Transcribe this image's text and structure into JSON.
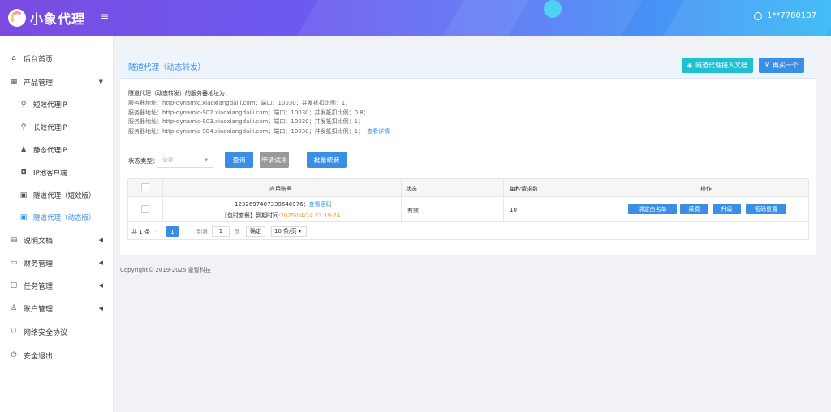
{
  "header": {
    "app_name": "小象代理",
    "menu_toggle": "≡",
    "username": "1**7780107"
  },
  "sidebar": {
    "items": [
      {
        "label": "后台首页",
        "icon": "home-icon"
      },
      {
        "label": "产品管理",
        "icon": "grid-icon"
      },
      {
        "label": "短效代理IP",
        "icon": "motorbike-icon"
      },
      {
        "label": "长效代理IP",
        "icon": "motorbike-icon"
      },
      {
        "label": "静态代理IP",
        "icon": "person-icon"
      },
      {
        "label": "IP池客户端",
        "icon": "car-icon"
      },
      {
        "label": "隧道代理（短效版）",
        "icon": "bus-icon"
      },
      {
        "label": "隧道代理（动态版）",
        "icon": "bus-icon"
      },
      {
        "label": "说明文档",
        "icon": "document-icon"
      },
      {
        "label": "财务管理",
        "icon": "folder-icon"
      },
      {
        "label": "任务管理",
        "icon": "calendar-icon"
      },
      {
        "label": "账户管理",
        "icon": "user-icon"
      },
      {
        "label": "网络安全协议",
        "icon": "shield-icon"
      },
      {
        "label": "安全退出",
        "icon": "power-icon"
      }
    ],
    "active_index": 7
  },
  "panel": {
    "title": "隧道代理（动态转发）",
    "doc_button": "隧道代理接入文档",
    "buy_button": "再买一个",
    "intro": "隧道代理（动态转发）的服务器地址为：",
    "servers": [
      "服务器地址：http-dynamic.xiaoxiangdaili.com；端口：10030；并发抵扣比例：1；",
      "服务器地址：http-dynamic-S02.xiaoxiangdaili.com；端口：10030；并发抵扣比例：0.8；",
      "服务器地址：http-dynamic-S03.xiaoxiangdaili.com；端口：10030；并发抵扣比例：1；",
      "服务器地址：http-dynamic-S04.xiaoxiangdaili.com；端口：10030；并发抵扣比例：1；"
    ],
    "details_link": "查看详情",
    "filter_label": "状态类型：",
    "filter_placeholder": "全部",
    "query_button": "查询",
    "trial_button": "申请试用",
    "renew_button": "批量续费"
  },
  "table": {
    "headers": [
      "应用账号",
      "状态",
      "每秒请求数",
      "操作"
    ],
    "rows": [
      {
        "account": "1232697407339646976",
        "view_password": "查看密码",
        "plan_label": "【包时套餐】到期时间:",
        "expire": "2025/04/24 23:19:24",
        "status": "有效",
        "rps": "10",
        "ops": [
          "绑定白名单",
          "续费",
          "升级",
          "密码重置"
        ]
      }
    ],
    "footer": {
      "total": "共 1 条",
      "current_page": "1",
      "goto_label": "到第",
      "goto_value": "1",
      "page_unit": "页",
      "confirm": "确定",
      "page_size": "10 条/页"
    }
  },
  "copyright": "Copyright© 2019-2025 象智科技"
}
